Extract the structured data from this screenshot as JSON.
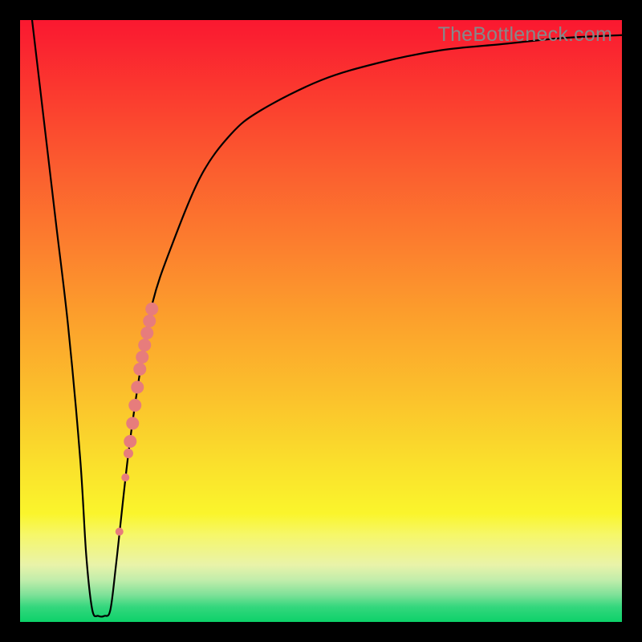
{
  "watermark": "TheBottleneck.com",
  "gradient_stops": [
    {
      "offset": 0.0,
      "color": "#fa1830"
    },
    {
      "offset": 0.125,
      "color": "#fb3b2f"
    },
    {
      "offset": 0.25,
      "color": "#fb5e2f"
    },
    {
      "offset": 0.375,
      "color": "#fc7f2e"
    },
    {
      "offset": 0.5,
      "color": "#fca12c"
    },
    {
      "offset": 0.625,
      "color": "#fbc12c"
    },
    {
      "offset": 0.75,
      "color": "#fae32c"
    },
    {
      "offset": 0.82,
      "color": "#faf52c"
    },
    {
      "offset": 0.855,
      "color": "#f6f769"
    },
    {
      "offset": 0.905,
      "color": "#e9f3a9"
    },
    {
      "offset": 0.93,
      "color": "#c2edab"
    },
    {
      "offset": 0.955,
      "color": "#7ee198"
    },
    {
      "offset": 0.975,
      "color": "#34d77d"
    },
    {
      "offset": 1.0,
      "color": "#0cd169"
    }
  ],
  "chart_data": {
    "type": "line",
    "title": "",
    "xlabel": "",
    "ylabel": "",
    "xlim": [
      0,
      100
    ],
    "ylim": [
      0,
      100
    ],
    "series": [
      {
        "name": "bottleneck-curve",
        "x": [
          2,
          4,
          6,
          8,
          10,
          11,
          12,
          13,
          14,
          15,
          16,
          18,
          20,
          22,
          25,
          30,
          35,
          40,
          50,
          60,
          70,
          80,
          90,
          100
        ],
        "values": [
          100,
          83,
          66,
          49,
          27,
          11,
          2,
          1,
          1,
          2,
          10,
          28,
          42,
          53,
          62,
          74,
          81,
          85,
          90,
          93,
          95,
          96,
          97,
          97.5
        ]
      }
    ],
    "points": {
      "name": "highlight-dots",
      "color": "#e77c7c",
      "data": [
        {
          "x": 16.5,
          "y": 15,
          "r": 5
        },
        {
          "x": 17.5,
          "y": 24,
          "r": 5
        },
        {
          "x": 18.0,
          "y": 28,
          "r": 6
        },
        {
          "x": 18.3,
          "y": 30,
          "r": 8
        },
        {
          "x": 18.7,
          "y": 33,
          "r": 8
        },
        {
          "x": 19.1,
          "y": 36,
          "r": 8
        },
        {
          "x": 19.5,
          "y": 39,
          "r": 8
        },
        {
          "x": 19.9,
          "y": 42,
          "r": 8
        },
        {
          "x": 20.3,
          "y": 44,
          "r": 8
        },
        {
          "x": 20.7,
          "y": 46,
          "r": 8
        },
        {
          "x": 21.1,
          "y": 48,
          "r": 8
        },
        {
          "x": 21.5,
          "y": 50,
          "r": 8
        },
        {
          "x": 21.9,
          "y": 52,
          "r": 8
        }
      ]
    }
  }
}
